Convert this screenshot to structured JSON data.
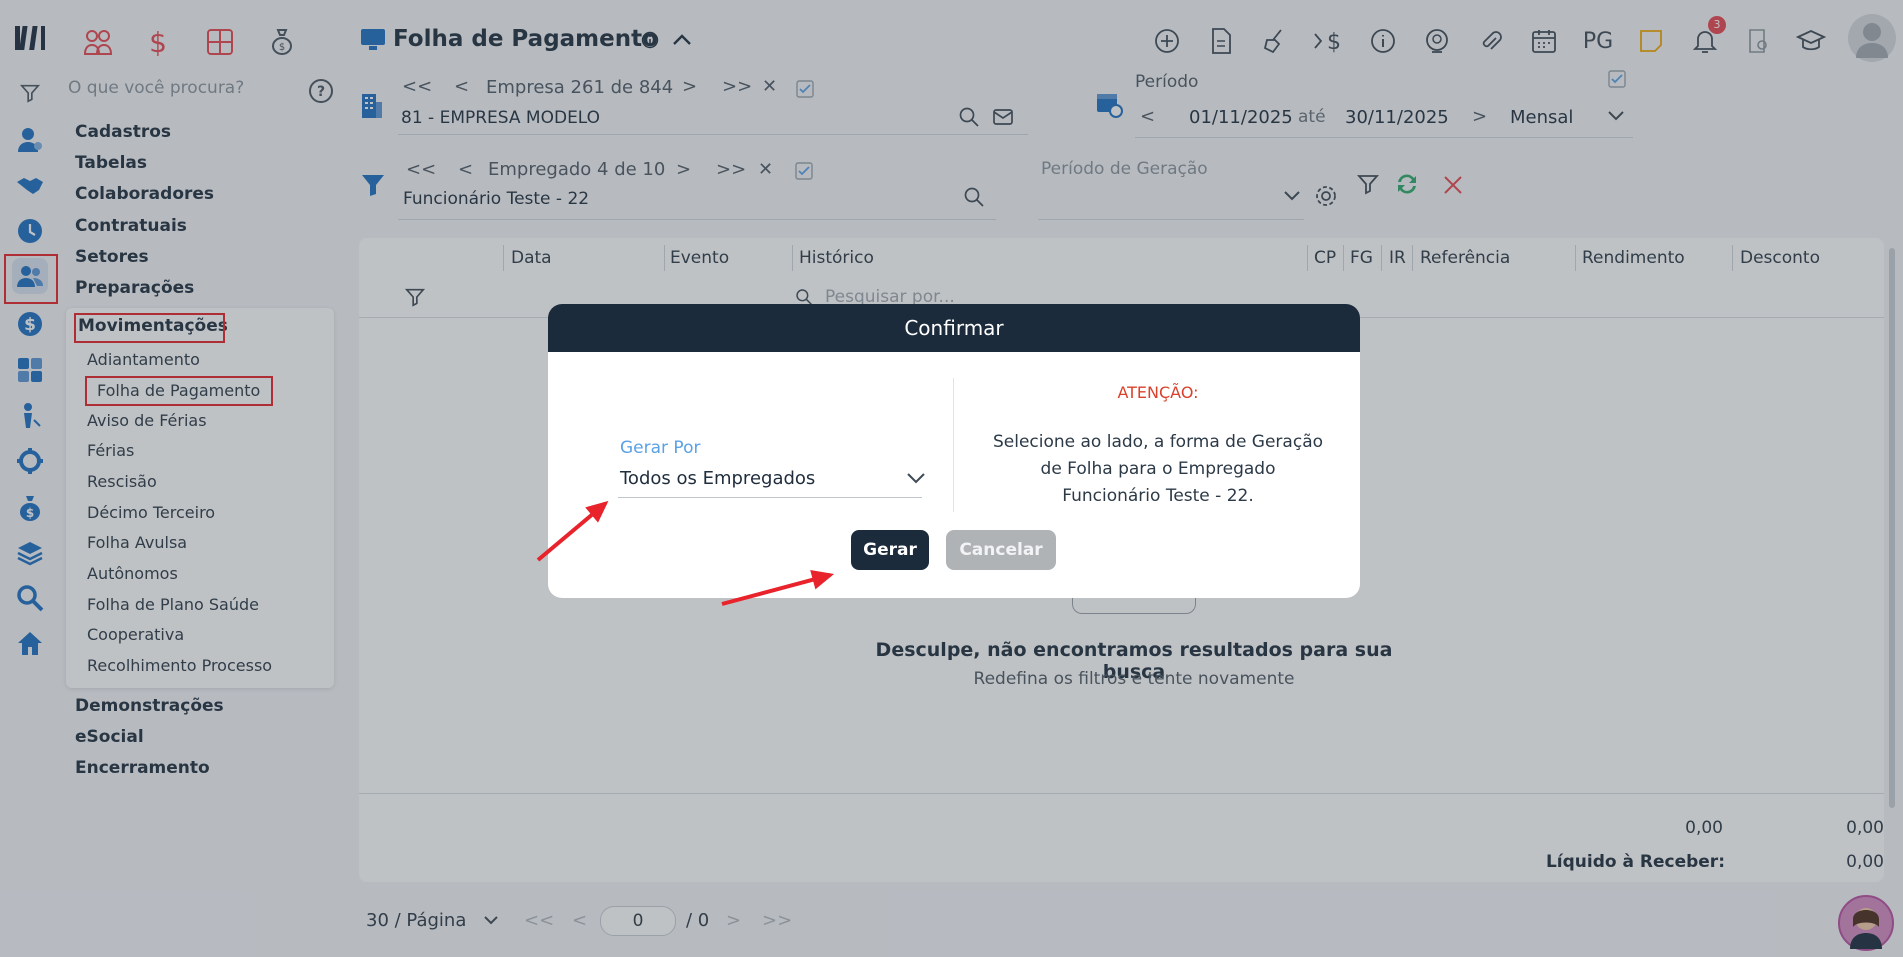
{
  "app": {
    "title": "Folha de Pagamento",
    "search_placeholder": "O que você procura?"
  },
  "menu": {
    "items_top": [
      "Cadastros",
      "Tabelas",
      "Colaboradores",
      "Contratuais",
      "Setores",
      "Preparações"
    ],
    "active_section": "Movimentações",
    "sub_items": [
      "Adiantamento",
      "Folha de Pagamento",
      "Aviso de Férias",
      "Férias",
      "Rescisão",
      "Décimo Terceiro",
      "Folha Avulsa",
      "Autônomos",
      "Folha de Plano Saúde",
      "Cooperativa",
      "Recolhimento Processo"
    ],
    "items_bottom": [
      "Demonstrações",
      "eSocial",
      "Encerramento"
    ]
  },
  "header": {
    "pg_label": "PG",
    "notif_count": "3"
  },
  "empresa": {
    "nav_label": "Empresa 261 de 844",
    "value": "81 - EMPRESA MODELO"
  },
  "periodo": {
    "label": "Período",
    "start": "01/11/2025",
    "sep": "até",
    "end": "30/11/2025",
    "mode": "Mensal"
  },
  "empregado": {
    "nav_label": "Empregado 4 de 10",
    "value": "Funcionário Teste - 22"
  },
  "periodo_geracao": {
    "label": "Período de Geração"
  },
  "table": {
    "columns": [
      "Data",
      "Evento",
      "Histórico",
      "CP",
      "FG",
      "IR",
      "Referência",
      "Rendimento",
      "Desconto"
    ],
    "search_placeholder": "Pesquisar por...",
    "empty_title": "Desculpe, não encontramos resultados para sua busca",
    "empty_sub": "Redefina os filtros e tente novamente",
    "total_rendimento": "0,00",
    "total_desconto": "0,00",
    "liquido_label": "Líquido à Receber:",
    "liquido_value": "0,00"
  },
  "pagination": {
    "per_page": "30 / Página",
    "current": "0",
    "total": "/ 0"
  },
  "modal": {
    "title": "Confirmar",
    "field_label": "Gerar Por",
    "field_value": "Todos os Empregados",
    "attention": "ATENÇÃO:",
    "message_line1": "Selecione ao lado, a forma de Geração",
    "message_line2": "de Folha para o Empregado",
    "message_line3": "Funcionário Teste - 22.",
    "confirm": "Gerar",
    "cancel": "Cancelar"
  },
  "colors": {
    "dark": "#1c2b3c",
    "accent_blue": "#1d6fc2",
    "red": "#e8232b",
    "attention": "#d9412b",
    "label_blue": "#5aa1e6"
  }
}
